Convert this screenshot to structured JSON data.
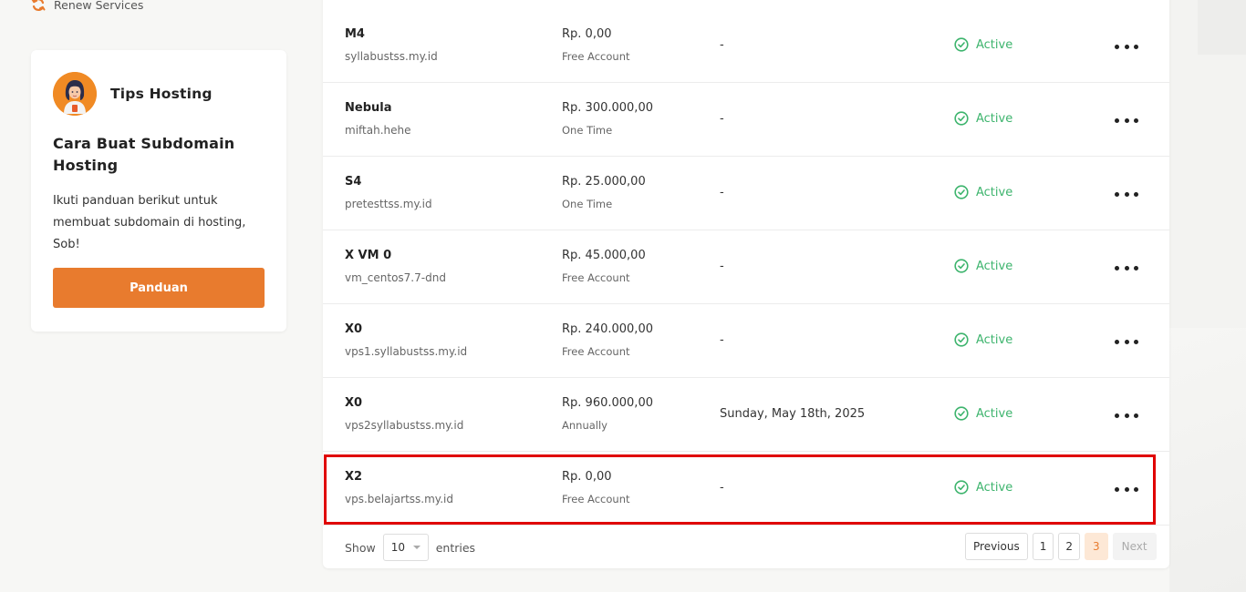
{
  "sidebar": {
    "renew_label": "Renew Services",
    "tips": {
      "title": "Tips Hosting",
      "heading": "Cara Buat Subdomain Hosting",
      "text": "Ikuti panduan berikut untuk membuat subdomain di hosting, Sob!",
      "button_label": "Panduan"
    }
  },
  "services": [
    {
      "name": "M4",
      "domain": "syllabustss.my.id",
      "price": "Rp. 0,00",
      "cycle": "Free Account",
      "due": "-",
      "status": "Active"
    },
    {
      "name": "Nebula",
      "domain": "miftah.hehe",
      "price": "Rp. 300.000,00",
      "cycle": "One Time",
      "due": "-",
      "status": "Active"
    },
    {
      "name": "S4",
      "domain": "pretesttss.my.id",
      "price": "Rp. 25.000,00",
      "cycle": "One Time",
      "due": "-",
      "status": "Active"
    },
    {
      "name": "X VM 0",
      "domain": "vm_centos7.7-dnd",
      "price": "Rp. 45.000,00",
      "cycle": "Free Account",
      "due": "-",
      "status": "Active"
    },
    {
      "name": "X0",
      "domain": "vps1.syllabustss.my.id",
      "price": "Rp. 240.000,00",
      "cycle": "Free Account",
      "due": "-",
      "status": "Active"
    },
    {
      "name": "X0",
      "domain": "vps2syllabustss.my.id",
      "price": "Rp. 960.000,00",
      "cycle": "Annually",
      "due": "Sunday, May 18th, 2025",
      "status": "Active"
    },
    {
      "name": "X2",
      "domain": "vps.belajartss.my.id",
      "price": "Rp. 0,00",
      "cycle": "Free Account",
      "due": "-",
      "status": "Active"
    }
  ],
  "footer": {
    "show_label": "Show",
    "entries_value": "10",
    "entries_label": "entries",
    "pagination": {
      "previous": "Previous",
      "pages": [
        "1",
        "2",
        "3"
      ],
      "current": "3",
      "next": "Next"
    }
  },
  "colors": {
    "accent": "#e87b2e",
    "status_active": "#3db46d",
    "highlight": "#e00000"
  }
}
